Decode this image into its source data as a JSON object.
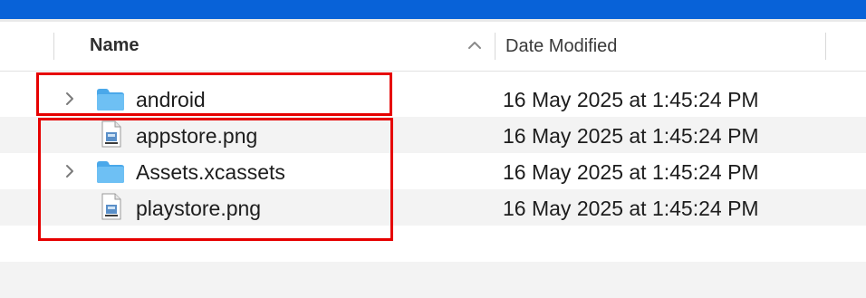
{
  "header": {
    "name_label": "Name",
    "date_label": "Date Modified",
    "sort_direction": "ascending"
  },
  "files": [
    {
      "name": "android",
      "date": "16 May 2025 at 1:45:24 PM",
      "type": "folder",
      "expandable": true
    },
    {
      "name": "appstore.png",
      "date": "16 May 2025 at 1:45:24 PM",
      "type": "png",
      "expandable": false
    },
    {
      "name": "Assets.xcassets",
      "date": "16 May 2025 at 1:45:24 PM",
      "type": "folder",
      "expandable": true
    },
    {
      "name": "playstore.png",
      "date": "16 May 2025 at 1:45:24 PM",
      "type": "png",
      "expandable": false
    }
  ],
  "colors": {
    "titlebar": "#0862d8",
    "folder": "#5fb4ee",
    "highlight": "#e60000",
    "alt_row": "#f3f3f3"
  },
  "icons": [
    "chevron-right-icon",
    "folder-icon",
    "png-file-icon",
    "sort-up-icon"
  ]
}
